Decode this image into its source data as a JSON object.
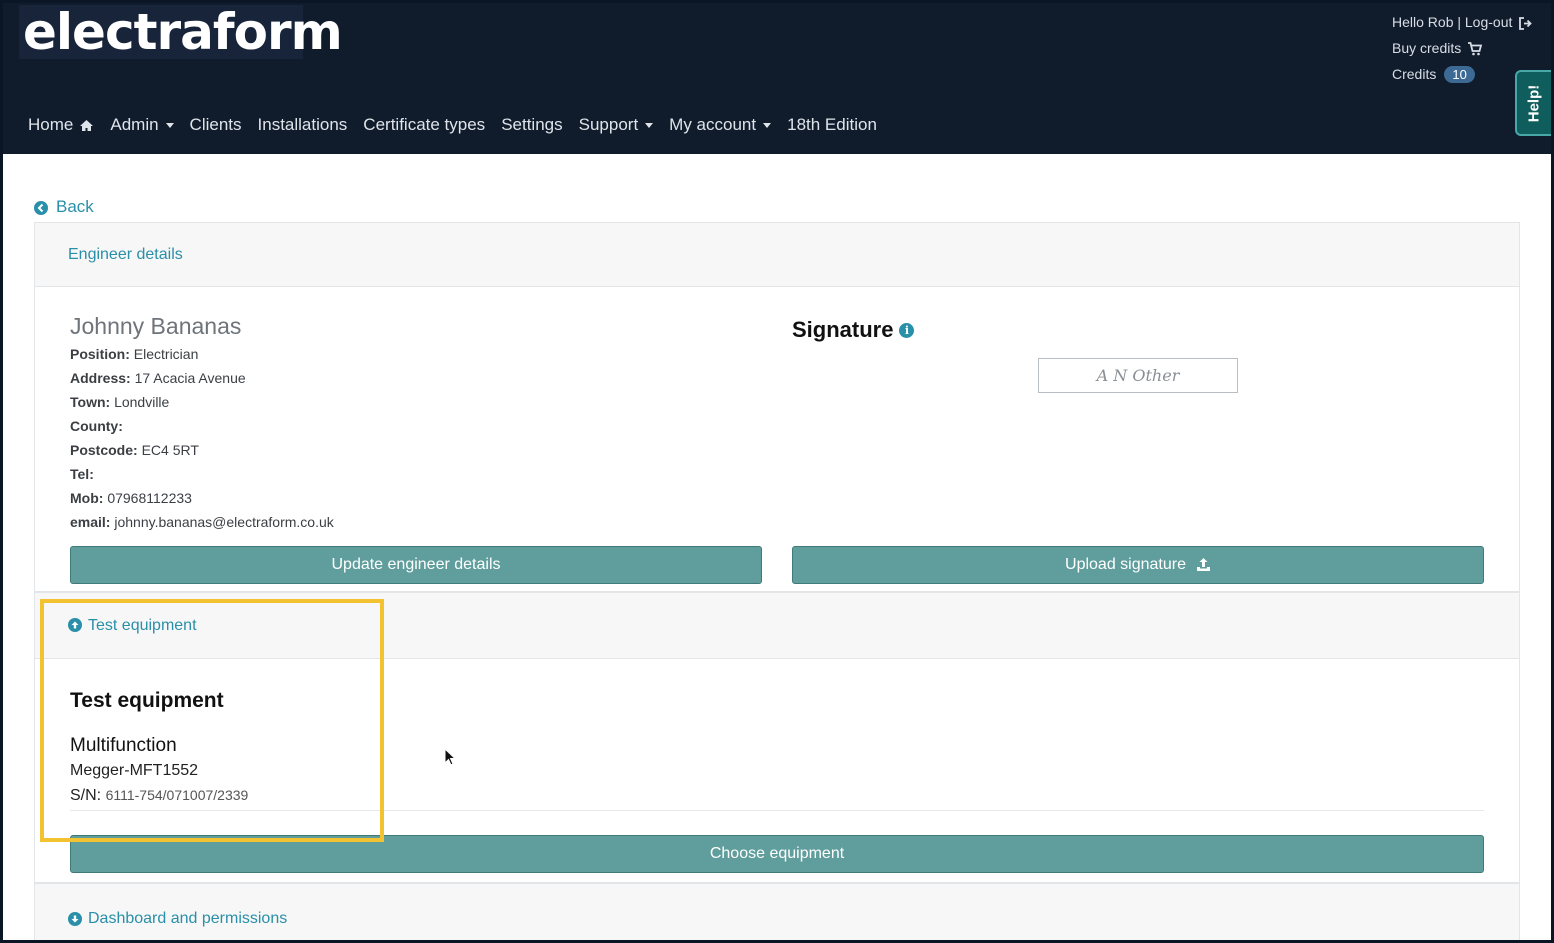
{
  "header": {
    "logo_text": "electraform",
    "greeting": "Hello Rob | Log-out",
    "buy_credits": "Buy credits",
    "credits_label": "Credits",
    "credits_count": "10",
    "help_tab": "Help!"
  },
  "nav": {
    "items": [
      {
        "label": "Home",
        "icon": "home-icon"
      },
      {
        "label": "Admin",
        "dropdown": true
      },
      {
        "label": "Clients"
      },
      {
        "label": "Installations"
      },
      {
        "label": "Certificate types"
      },
      {
        "label": "Settings"
      },
      {
        "label": "Support",
        "dropdown": true
      },
      {
        "label": "My account",
        "dropdown": true
      },
      {
        "label": "18th Edition"
      }
    ]
  },
  "back_label": "Back",
  "engineer": {
    "section_title": "Engineer details",
    "name": "Johnny Bananas",
    "fields": [
      {
        "label": "Position:",
        "value": "Electrician"
      },
      {
        "label": "Address:",
        "value": "17 Acacia Avenue"
      },
      {
        "label": "Town:",
        "value": "Londville"
      },
      {
        "label": "County:",
        "value": ""
      },
      {
        "label": "Postcode:",
        "value": "EC4 5RT"
      },
      {
        "label": "Tel:",
        "value": ""
      },
      {
        "label": "Mob:",
        "value": "07968112233"
      },
      {
        "label": "email:",
        "value": "johnny.bananas@electraform.co.uk"
      }
    ],
    "signature_title": "Signature",
    "signature_text": "A N Other",
    "update_button": "Update engineer details",
    "upload_button": "Upload signature"
  },
  "test_equipment": {
    "section_title": "Test equipment",
    "heading": "Test equipment",
    "type": "Multifunction",
    "model": "Megger-MFT1552",
    "sn_label": "S/N:",
    "sn_value": "6111-754/071007/2339",
    "choose_button": "Choose equipment"
  },
  "dashboard": {
    "section_title": "Dashboard and permissions"
  },
  "colors": {
    "header_bg": "#101c2c",
    "accent_link": "#2a8fa8",
    "button_bg": "#5f9e9c",
    "highlight": "#f2c230",
    "help_tab": "#0f5d5d"
  }
}
